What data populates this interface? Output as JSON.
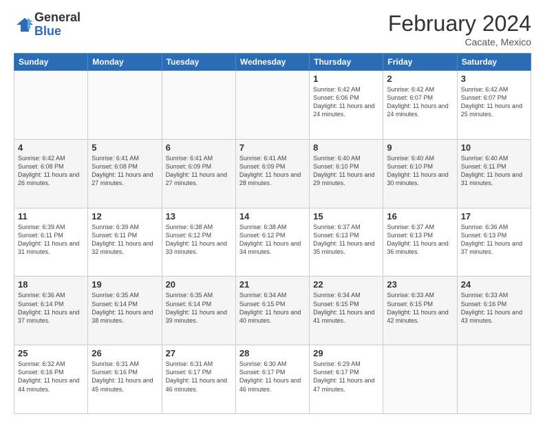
{
  "header": {
    "logo_general": "General",
    "logo_blue": "Blue",
    "title": "February 2024",
    "subtitle": "Cacate, Mexico"
  },
  "days_of_week": [
    "Sunday",
    "Monday",
    "Tuesday",
    "Wednesday",
    "Thursday",
    "Friday",
    "Saturday"
  ],
  "weeks": [
    [
      {
        "day": "",
        "info": ""
      },
      {
        "day": "",
        "info": ""
      },
      {
        "day": "",
        "info": ""
      },
      {
        "day": "",
        "info": ""
      },
      {
        "day": "1",
        "info": "Sunrise: 6:42 AM\nSunset: 6:06 PM\nDaylight: 11 hours and 24 minutes."
      },
      {
        "day": "2",
        "info": "Sunrise: 6:42 AM\nSunset: 6:07 PM\nDaylight: 11 hours and 24 minutes."
      },
      {
        "day": "3",
        "info": "Sunrise: 6:42 AM\nSunset: 6:07 PM\nDaylight: 11 hours and 25 minutes."
      }
    ],
    [
      {
        "day": "4",
        "info": "Sunrise: 6:42 AM\nSunset: 6:08 PM\nDaylight: 11 hours and 26 minutes."
      },
      {
        "day": "5",
        "info": "Sunrise: 6:41 AM\nSunset: 6:08 PM\nDaylight: 11 hours and 27 minutes."
      },
      {
        "day": "6",
        "info": "Sunrise: 6:41 AM\nSunset: 6:09 PM\nDaylight: 11 hours and 27 minutes."
      },
      {
        "day": "7",
        "info": "Sunrise: 6:41 AM\nSunset: 6:09 PM\nDaylight: 11 hours and 28 minutes."
      },
      {
        "day": "8",
        "info": "Sunrise: 6:40 AM\nSunset: 6:10 PM\nDaylight: 11 hours and 29 minutes."
      },
      {
        "day": "9",
        "info": "Sunrise: 6:40 AM\nSunset: 6:10 PM\nDaylight: 11 hours and 30 minutes."
      },
      {
        "day": "10",
        "info": "Sunrise: 6:40 AM\nSunset: 6:11 PM\nDaylight: 11 hours and 31 minutes."
      }
    ],
    [
      {
        "day": "11",
        "info": "Sunrise: 6:39 AM\nSunset: 6:11 PM\nDaylight: 11 hours and 31 minutes."
      },
      {
        "day": "12",
        "info": "Sunrise: 6:39 AM\nSunset: 6:11 PM\nDaylight: 11 hours and 32 minutes."
      },
      {
        "day": "13",
        "info": "Sunrise: 6:38 AM\nSunset: 6:12 PM\nDaylight: 11 hours and 33 minutes."
      },
      {
        "day": "14",
        "info": "Sunrise: 6:38 AM\nSunset: 6:12 PM\nDaylight: 11 hours and 34 minutes."
      },
      {
        "day": "15",
        "info": "Sunrise: 6:37 AM\nSunset: 6:13 PM\nDaylight: 11 hours and 35 minutes."
      },
      {
        "day": "16",
        "info": "Sunrise: 6:37 AM\nSunset: 6:13 PM\nDaylight: 11 hours and 36 minutes."
      },
      {
        "day": "17",
        "info": "Sunrise: 6:36 AM\nSunset: 6:13 PM\nDaylight: 11 hours and 37 minutes."
      }
    ],
    [
      {
        "day": "18",
        "info": "Sunrise: 6:36 AM\nSunset: 6:14 PM\nDaylight: 11 hours and 37 minutes."
      },
      {
        "day": "19",
        "info": "Sunrise: 6:35 AM\nSunset: 6:14 PM\nDaylight: 11 hours and 38 minutes."
      },
      {
        "day": "20",
        "info": "Sunrise: 6:35 AM\nSunset: 6:14 PM\nDaylight: 11 hours and 39 minutes."
      },
      {
        "day": "21",
        "info": "Sunrise: 6:34 AM\nSunset: 6:15 PM\nDaylight: 11 hours and 40 minutes."
      },
      {
        "day": "22",
        "info": "Sunrise: 6:34 AM\nSunset: 6:15 PM\nDaylight: 11 hours and 41 minutes."
      },
      {
        "day": "23",
        "info": "Sunrise: 6:33 AM\nSunset: 6:15 PM\nDaylight: 11 hours and 42 minutes."
      },
      {
        "day": "24",
        "info": "Sunrise: 6:33 AM\nSunset: 6:16 PM\nDaylight: 11 hours and 43 minutes."
      }
    ],
    [
      {
        "day": "25",
        "info": "Sunrise: 6:32 AM\nSunset: 6:16 PM\nDaylight: 11 hours and 44 minutes."
      },
      {
        "day": "26",
        "info": "Sunrise: 6:31 AM\nSunset: 6:16 PM\nDaylight: 11 hours and 45 minutes."
      },
      {
        "day": "27",
        "info": "Sunrise: 6:31 AM\nSunset: 6:17 PM\nDaylight: 11 hours and 46 minutes."
      },
      {
        "day": "28",
        "info": "Sunrise: 6:30 AM\nSunset: 6:17 PM\nDaylight: 11 hours and 46 minutes."
      },
      {
        "day": "29",
        "info": "Sunrise: 6:29 AM\nSunset: 6:17 PM\nDaylight: 11 hours and 47 minutes."
      },
      {
        "day": "",
        "info": ""
      },
      {
        "day": "",
        "info": ""
      }
    ]
  ]
}
